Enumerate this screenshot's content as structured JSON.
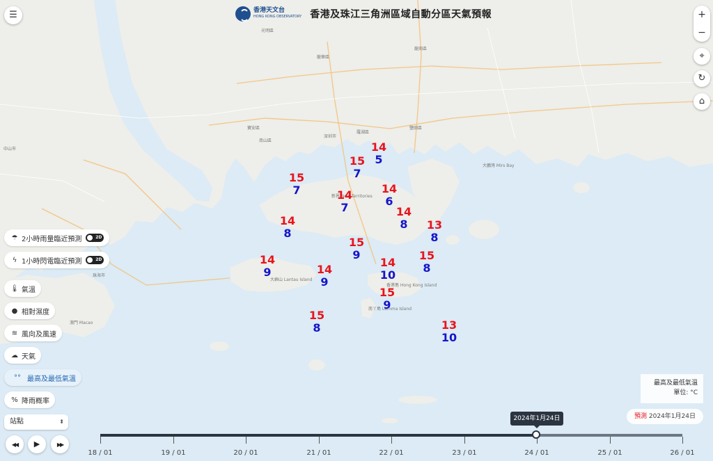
{
  "header": {
    "org_zh": "香港天文台",
    "org_en": "HONG KONG OBSERVATORY",
    "title": "香港及珠江三角洲區域自動分區天氣預報"
  },
  "controls": {
    "menu_icon": "menu-icon",
    "zoom_in": "+",
    "zoom_out": "−",
    "locate_icon": "crosshair-icon",
    "refresh_icon": "refresh-icon",
    "home_icon": "home-icon"
  },
  "layers": [
    {
      "label": "2小時雨量臨近預測",
      "icon": "rain-cloud-icon",
      "toggle": "2D"
    },
    {
      "label": "1小時閃電臨近預測",
      "icon": "lightning-icon",
      "toggle": "2D"
    },
    {
      "label": "氣溫",
      "icon": "thermometer-icon"
    },
    {
      "label": "相對濕度",
      "icon": "droplet-icon"
    },
    {
      "label": "風向及風速",
      "icon": "wind-icon"
    },
    {
      "label": "天氣",
      "icon": "sun-cloud-icon"
    },
    {
      "label": "最高及最低氣溫",
      "icon": "thermometer-pair-icon",
      "active": true
    },
    {
      "label": "降雨概率",
      "icon": "percent-icon"
    }
  ],
  "station_select": {
    "value": "站點"
  },
  "playback": {
    "rewind": "◀◀",
    "play": "▶",
    "forward": "▶▶"
  },
  "legend": {
    "line1": "最高及最低氣溫",
    "line2": "單位: °C"
  },
  "forecast": {
    "label": "預測",
    "date": "2024年1月24日"
  },
  "timeline": {
    "labels": [
      "18 / 01",
      "19 / 01",
      "20 / 01",
      "21 / 01",
      "22 / 01",
      "23 / 01",
      "24 / 01",
      "25 / 01",
      "26 / 01"
    ],
    "selected": "2024年1月24日"
  },
  "temperatures": [
    {
      "max": "14",
      "min": "5"
    },
    {
      "max": "15",
      "min": "7"
    },
    {
      "max": "15",
      "min": "7"
    },
    {
      "max": "14",
      "min": "7"
    },
    {
      "max": "14",
      "min": "6"
    },
    {
      "max": "14",
      "min": "8"
    },
    {
      "max": "14",
      "min": "8"
    },
    {
      "max": "13",
      "min": "8"
    },
    {
      "max": "15",
      "min": "9"
    },
    {
      "max": "15",
      "min": "8"
    },
    {
      "max": "14",
      "min": "9"
    },
    {
      "max": "14",
      "min": "9"
    },
    {
      "max": "14",
      "min": "10"
    },
    {
      "max": "15",
      "min": "9"
    },
    {
      "max": "15",
      "min": "8"
    },
    {
      "max": "13",
      "min": "10"
    }
  ],
  "places": {
    "shenzhen": "深圳市",
    "nanshan": "南山區",
    "baoan": "寶安區",
    "luohu": "羅湖區",
    "longgang": "龍崗區",
    "zhongshan": "中山市",
    "zhuhai": "珠海市",
    "macao": "澳門 Macao",
    "dapeng_bay": "大鵬灣 Mirs Bay",
    "lantau": "大嶼山 Lantau Island",
    "hk_island": "香港島 Hong Kong Island",
    "new_territories": "新界 New Territories",
    "lamma": "南丫島 Lamma Island",
    "guangming": "光明區",
    "longhua": "龍華區",
    "yantian": "鹽田區"
  }
}
